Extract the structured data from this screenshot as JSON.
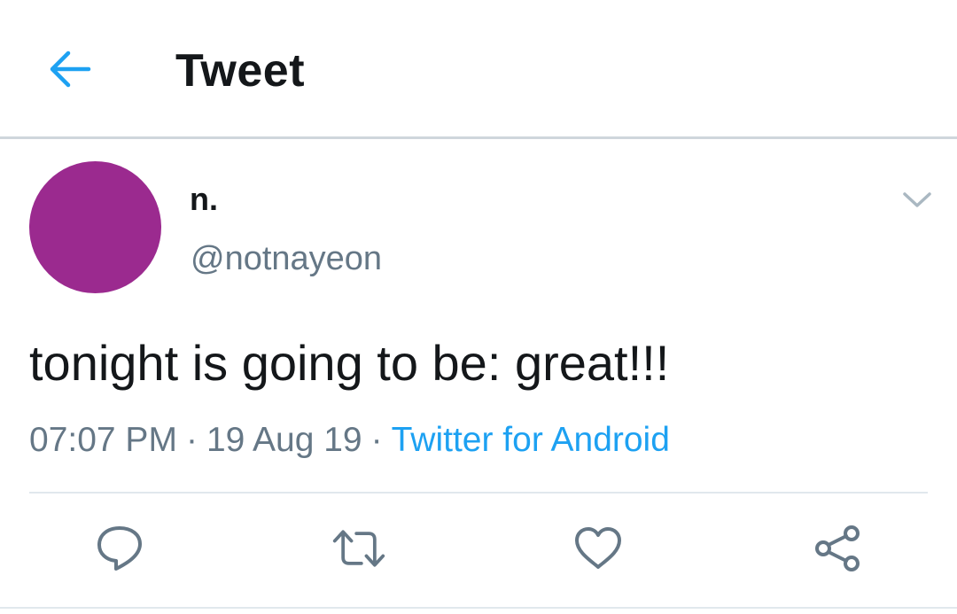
{
  "header": {
    "title": "Tweet",
    "back_icon": "arrow-left-icon",
    "accent_color": "#1da1f2"
  },
  "tweet": {
    "avatar_color": "#9b2a8f",
    "display_name": "n.",
    "handle": "@notnayeon",
    "caret_icon": "chevron-down-icon",
    "text": "tonight is going to be: great!!!",
    "time": "07:07 PM",
    "separator": "·",
    "date": "19 Aug 19",
    "source": "Twitter for Android",
    "source_color": "#1da1f2"
  },
  "actions": [
    {
      "name": "reply",
      "icon": "comment-icon"
    },
    {
      "name": "retweet",
      "icon": "retweet-icon"
    },
    {
      "name": "like",
      "icon": "heart-icon"
    },
    {
      "name": "share",
      "icon": "share-icon"
    }
  ]
}
